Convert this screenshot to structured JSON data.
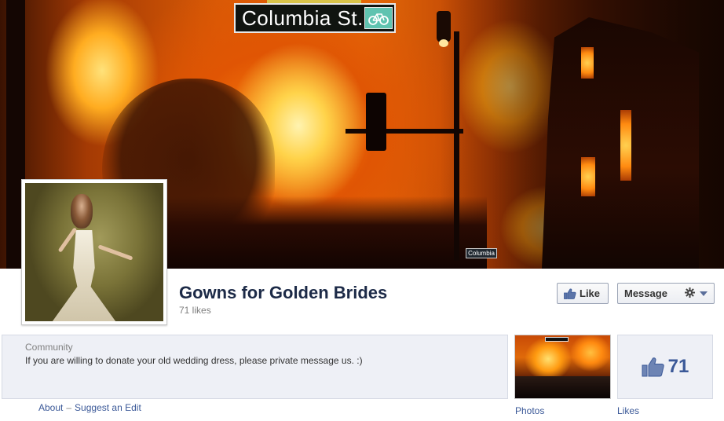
{
  "cover": {
    "street_sign": "Columbia St.",
    "small_sign": "Columbia"
  },
  "page": {
    "title": "Gowns for Golden Brides",
    "likes_text": "71 likes"
  },
  "actions": {
    "like_label": "Like",
    "message_label": "Message",
    "gear_icon": "gear-icon"
  },
  "about": {
    "category": "Community",
    "description": "If you are willing to donate your old wedding dress, please private message us. :)",
    "about_link": "About",
    "separator": "–",
    "edit_link": "Suggest an Edit"
  },
  "tiles": {
    "photos_label": "Photos",
    "likes_number": "71",
    "likes_label": "Likes"
  },
  "colors": {
    "title": "#1c2a47",
    "link": "#3b5998",
    "panel": "#eef0f6"
  }
}
